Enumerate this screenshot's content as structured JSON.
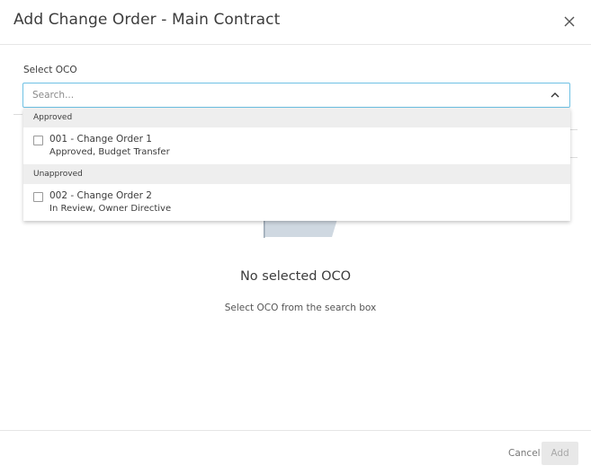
{
  "dialog": {
    "title": "Add Change Order - Main Contract"
  },
  "select_oco": {
    "label": "Select OCO",
    "search_placeholder": "Search...",
    "search_value": ""
  },
  "dropdown": {
    "groups": [
      {
        "header": "Approved",
        "options": [
          {
            "title": "001 - Change Order 1",
            "subtitle": "Approved, Budget Transfer",
            "checked": false
          }
        ]
      },
      {
        "header": "Unapproved",
        "options": [
          {
            "title": "002 - Change Order 2",
            "subtitle": "In Review, Owner Directive",
            "checked": false
          }
        ]
      }
    ]
  },
  "empty_state": {
    "title": "No selected OCO",
    "subtitle": "Select OCO from the search box"
  },
  "footer": {
    "cancel_label": "Cancel",
    "add_label": "Add"
  },
  "colors": {
    "accent_border": "#6ec1e4",
    "group_header_bg": "#eeeeee",
    "disabled_button_bg": "#e8e8e8",
    "illustration_fill": "#cfd8e1"
  },
  "icons": {
    "close": "close-icon",
    "chevron": "chevron-up-icon",
    "checkbox": "checkbox-icon",
    "illustration": "empty-state-illustration"
  }
}
